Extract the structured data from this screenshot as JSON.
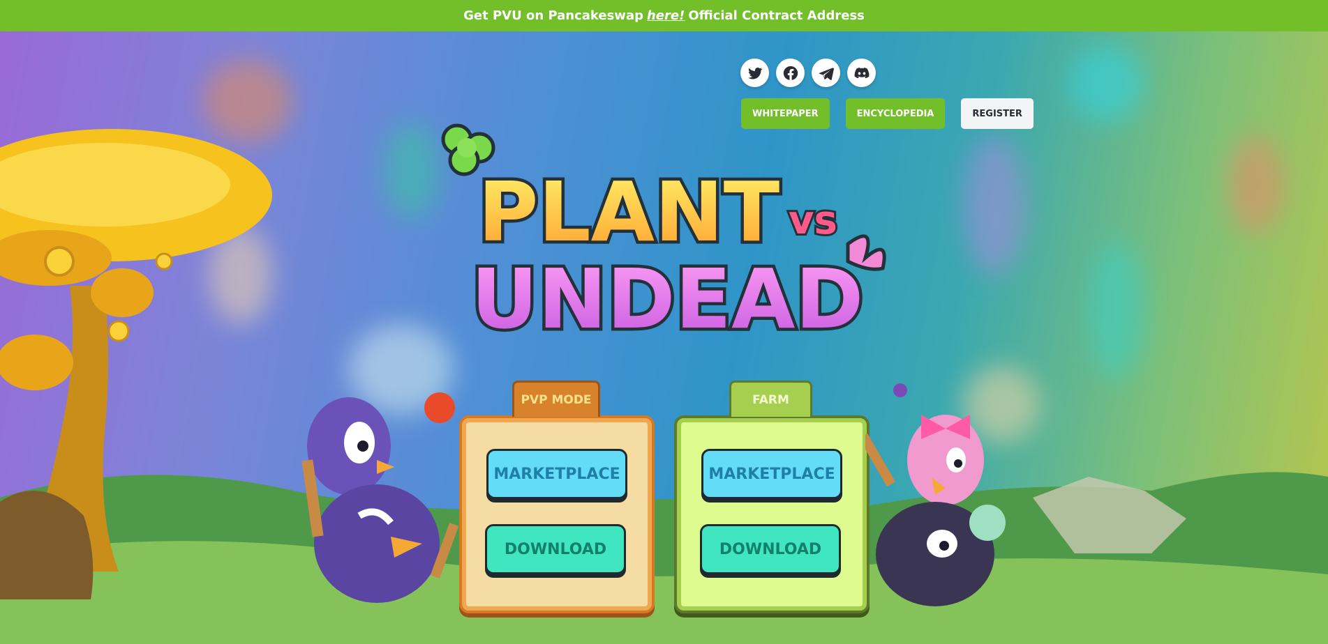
{
  "banner": {
    "prefix": "Get PVU on Pancakeswap",
    "link": "here!",
    "suffix": "Official Contract Address"
  },
  "socials": [
    {
      "name": "twitter"
    },
    {
      "name": "facebook"
    },
    {
      "name": "telegram"
    },
    {
      "name": "discord"
    }
  ],
  "nav": {
    "whitepaper": "WHITEPAPER",
    "encyclopedia": "ENCYCLOPEDIA",
    "register": "REGISTER"
  },
  "logo": {
    "line1": "PLANT",
    "vs": "vs",
    "line2": "UNDEAD"
  },
  "modes": {
    "pvp": {
      "tab": "PVP MODE",
      "marketplace": "MARKETPLACE",
      "download": "DOWNLOAD"
    },
    "farm": {
      "tab": "FARM",
      "marketplace": "MARKETPLACE",
      "download": "DOWNLOAD"
    }
  },
  "colors": {
    "banner": "#72bf2a",
    "pvp_card": "#f4dca2",
    "farm_card": "#ddfb8f",
    "marketplace_button": "#63dcf7",
    "download_button": "#3fe6c0"
  }
}
